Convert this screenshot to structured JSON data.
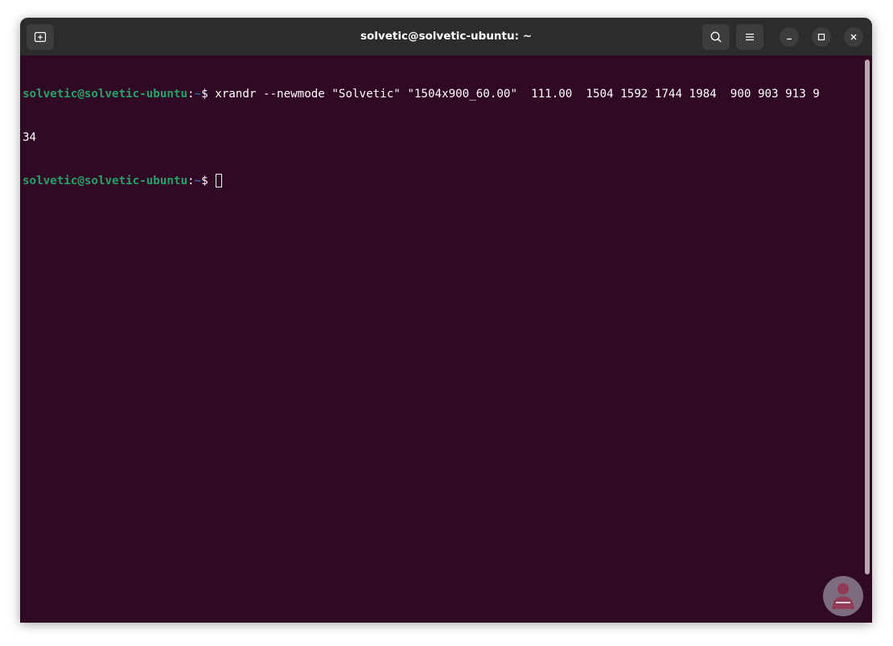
{
  "window": {
    "title": "solvetic@solvetic-ubuntu: ~"
  },
  "toolbar": {
    "new_tab_icon": "new-tab-icon",
    "search_icon": "search-icon",
    "menu_icon": "hamburger-menu-icon",
    "minimize_icon": "minimize-icon",
    "maximize_icon": "maximize-icon",
    "close_icon": "close-icon"
  },
  "terminal": {
    "lines": [
      {
        "user": "solvetic@solvetic-ubuntu",
        "colon": ":",
        "path": "~",
        "dollar": "$ ",
        "command": "xrandr --newmode \"Solvetic\" \"1504x900_60.00\"  111.00  1504 1592 1744 1984  900 903 913 9"
      },
      {
        "output": "34"
      },
      {
        "user": "solvetic@solvetic-ubuntu",
        "colon": ":",
        "path": "~",
        "dollar": "$ ",
        "command": ""
      }
    ]
  },
  "colors": {
    "terminal_bg": "#300a24",
    "titlebar_bg": "#2c2c2c",
    "prompt_user": "#26a269",
    "prompt_path": "#3465a4"
  }
}
